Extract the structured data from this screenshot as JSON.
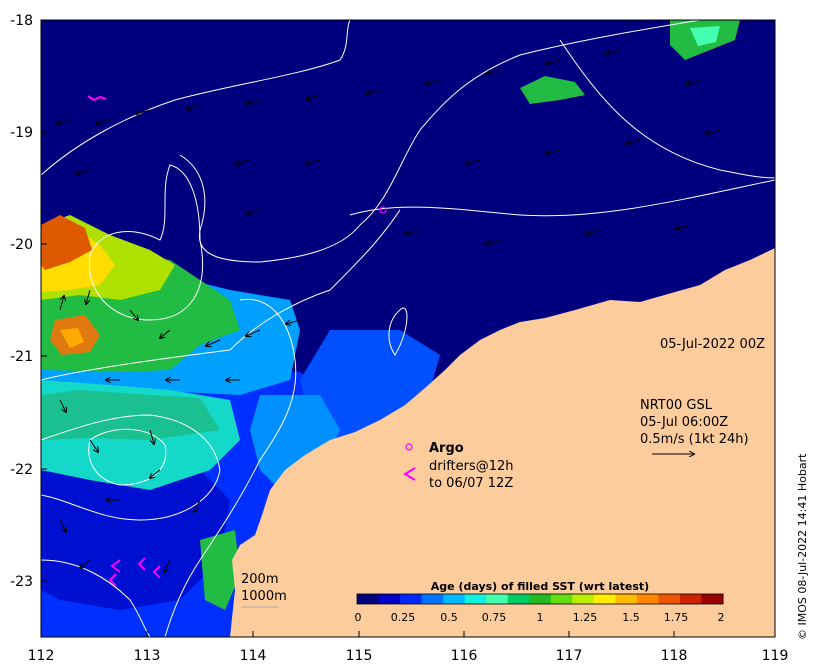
{
  "map": {
    "x_ticks": [
      "112",
      "113",
      "114",
      "115",
      "116",
      "117",
      "118",
      "119"
    ],
    "y_ticks": [
      "-18",
      "-19",
      "-20",
      "-21",
      "-22",
      "-23"
    ],
    "date_label": "05-Jul-2022 00Z",
    "current_legend": {
      "line1": "NRT00 GSL",
      "line2": "05-Jul 06:00Z",
      "line3": "0.5m/s (1kt 24h)"
    },
    "argo_label": "Argo",
    "drifter_line1": "drifters@12h",
    "drifter_line2": "to 06/07 12Z",
    "depth_200": "200m",
    "depth_1000": "1000m",
    "colorbar": {
      "title": "Age (days) of filled SST (wrt latest)",
      "tick_labels": [
        "0",
        "0.25",
        "0.5",
        "0.75",
        "1",
        "1.25",
        "1.5",
        "1.75",
        "2"
      ],
      "colors": [
        "#00007f",
        "#0000c8",
        "#0028ff",
        "#0074ff",
        "#00b8ff",
        "#14f0e0",
        "#45ffb0",
        "#00cc66",
        "#22bb22",
        "#66dd11",
        "#bbee00",
        "#ffee00",
        "#ffbb00",
        "#ff8800",
        "#ee5500",
        "#cc2200",
        "#990000"
      ]
    },
    "credit": "© IMOS 08-Jul-2022 14:41 Hobart",
    "colors": {
      "ocean_deep": "#00007f",
      "land": "#fccc9c",
      "argo": "#ff00ff",
      "drifter": "#ff00ff"
    }
  }
}
